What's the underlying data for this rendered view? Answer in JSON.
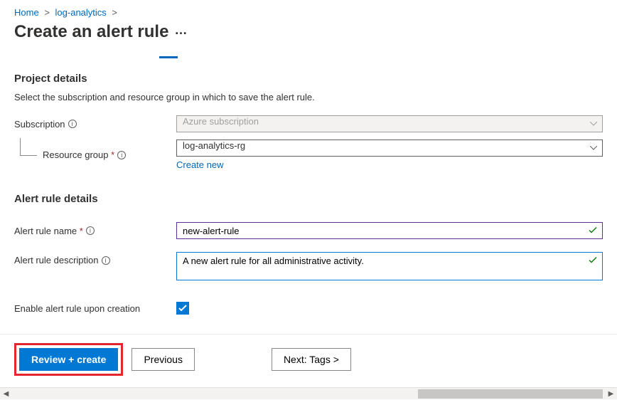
{
  "breadcrumb": {
    "home": "Home",
    "parent": "log-analytics"
  },
  "title": "Create an alert rule",
  "sections": {
    "project": {
      "heading": "Project details",
      "subtext": "Select the subscription and resource group in which to save the alert rule."
    },
    "details": {
      "heading": "Alert rule details"
    }
  },
  "fields": {
    "subscription": {
      "label": "Subscription",
      "value": "Azure subscription"
    },
    "resource_group": {
      "label": "Resource group",
      "value": "log-analytics-rg",
      "create_new": "Create new"
    },
    "alert_name": {
      "label": "Alert rule name",
      "value": "new-alert-rule"
    },
    "alert_desc": {
      "label": "Alert rule description",
      "value": "A new alert rule for all administrative activity."
    },
    "enable": {
      "label": "Enable alert rule upon creation",
      "checked": true
    }
  },
  "buttons": {
    "review": "Review + create",
    "previous": "Previous",
    "next": "Next: Tags >"
  }
}
